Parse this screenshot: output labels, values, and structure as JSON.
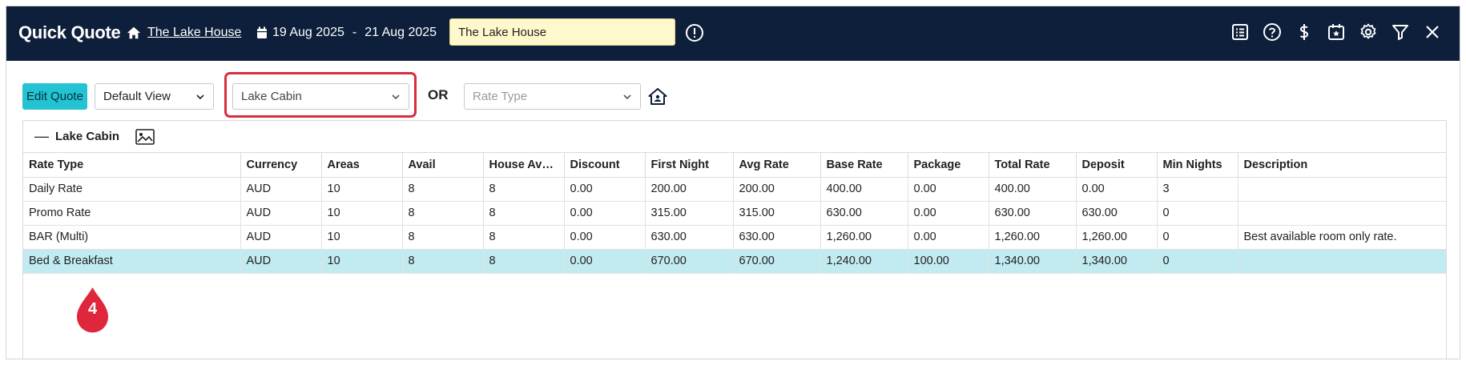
{
  "header": {
    "title": "Quick Quote",
    "property_link": "The Lake House",
    "date_from": "19 Aug 2025",
    "date_sep": "-",
    "date_to": "21 Aug 2025",
    "property_input_value": "The Lake House",
    "icons": [
      "home-icon",
      "calendar-icon",
      "alert-icon",
      "list-icon",
      "help-icon",
      "dollar-icon",
      "calendar-star-icon",
      "gear-icon",
      "filter-icon",
      "close-icon"
    ]
  },
  "toolbar": {
    "edit_label": "Edit Quote",
    "view_select": "Default View",
    "room_select": "Lake Cabin",
    "or_label": "OR",
    "rate_type_placeholder": "Rate Type",
    "highlight_color": "#d62e3e"
  },
  "panel": {
    "title": "Lake Cabin",
    "columns": [
      "Rate Type",
      "Currency",
      "Areas",
      "Avail",
      "House Avail...",
      "Discount",
      "First Night",
      "Avg Rate",
      "Base Rate",
      "Package",
      "Total Rate",
      "Deposit",
      "Min Nights",
      "Description"
    ],
    "rows": [
      [
        "Daily Rate",
        "AUD",
        "10",
        "8",
        "8",
        "0.00",
        "200.00",
        "200.00",
        "400.00",
        "0.00",
        "400.00",
        "0.00",
        "3",
        ""
      ],
      [
        "Promo Rate",
        "AUD",
        "10",
        "8",
        "8",
        "0.00",
        "315.00",
        "315.00",
        "630.00",
        "0.00",
        "630.00",
        "630.00",
        "0",
        ""
      ],
      [
        "BAR (Multi)",
        "AUD",
        "10",
        "8",
        "8",
        "0.00",
        "630.00",
        "630.00",
        "1,260.00",
        "0.00",
        "1,260.00",
        "1,260.00",
        "0",
        "Best available room only rate."
      ],
      [
        "Bed & Breakfast",
        "AUD",
        "10",
        "8",
        "8",
        "0.00",
        "670.00",
        "670.00",
        "1,240.00",
        "100.00",
        "1,340.00",
        "1,340.00",
        "0",
        ""
      ]
    ],
    "selected_row": 3
  },
  "step_marker": {
    "number": "4",
    "color": "#e0263c"
  },
  "colors": {
    "header_bg": "#0d1f3a",
    "accent": "#23c3d4",
    "selected_row": "#c2ebf1",
    "input_bg": "#fff8cc"
  }
}
